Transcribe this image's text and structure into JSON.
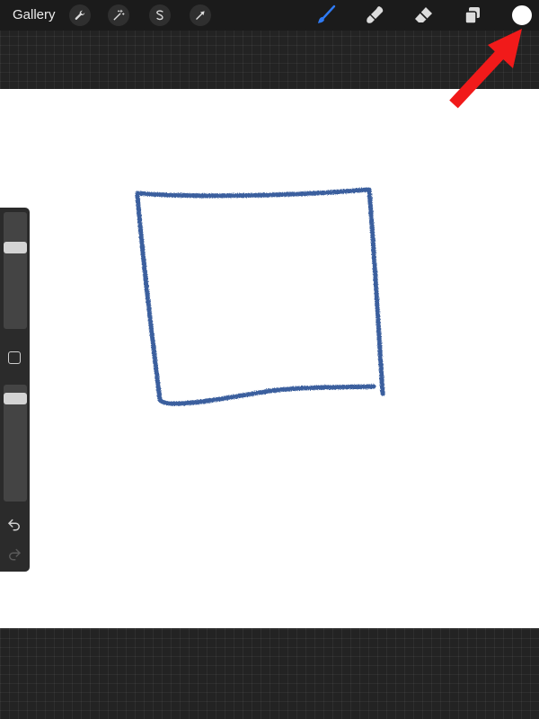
{
  "toolbar": {
    "gallery_label": "Gallery",
    "left_tools": [
      "wrench-icon",
      "magic-wand-icon",
      "selection-icon",
      "transform-arrow-icon"
    ],
    "right_tools": [
      "brush-icon",
      "smudge-icon",
      "eraser-icon",
      "layers-icon"
    ],
    "active_tool": "brush",
    "active_color": "#ffffff",
    "accent_color": "#2f7bf5"
  },
  "sidebar": {
    "brush_size_level": 0.28,
    "opacity_level": 0.08,
    "undo_icon": "undo-icon",
    "redo_icon": "redo-icon"
  },
  "canvas": {
    "background": "#ffffff",
    "stroke_color": "#3a5f9e",
    "drawn_shape": "hand-drawn square"
  },
  "annotation": {
    "arrow_color": "#f11a1a"
  }
}
